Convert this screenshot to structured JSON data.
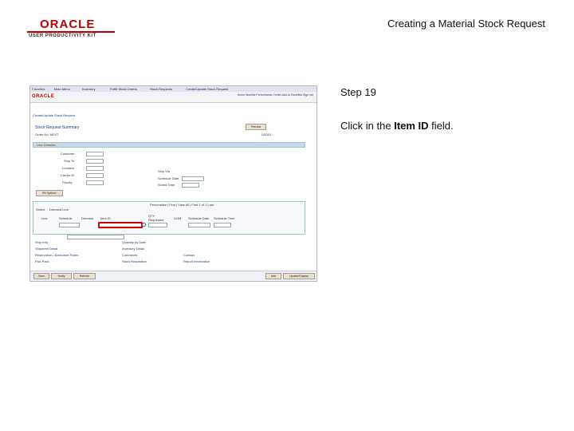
{
  "logo": {
    "brand": "ORACLE",
    "product": "USER PRODUCTIVITY KIT"
  },
  "doc_title": "Creating a Material Stock Request",
  "step": "Step 19",
  "instruction": {
    "prefix": "Click in the ",
    "field": "Item ID",
    "suffix": " field."
  },
  "screenshot": {
    "breadcrumb": [
      "Favorites",
      "Main Menu",
      "Inventory",
      "Fulfill Stock Orders",
      "Stock Requests",
      "Create/Update Stock Request"
    ],
    "brand": "ORACLE",
    "top_links": "Home  Worklist  Performance Center  Add to Favorites  Sign out",
    "page_heading": "Create/Update Stock Request",
    "summary_title": "Stock Request Summary",
    "order_label": "Order No: NEXT",
    "business_unit": "US001",
    "preview_button": "Preview",
    "line_defaults": "Line Defaults",
    "fields": [
      "Customer",
      "Ship To",
      "Location",
      "Carrier ID",
      "Priority"
    ],
    "fields_right": [
      "Ship Via",
      "Schedule Date",
      "Sched Time"
    ],
    "fill_rebuild": "Fill Options",
    "table_tabs": [
      "Select",
      "Demand Line"
    ],
    "table_cols": [
      "Line",
      "Schedule",
      "Demand",
      "Item ID",
      "QTY Requested",
      "UOM",
      "Schedule Date",
      "Schedule Time"
    ],
    "table_nav": "Personalize | Find | View All | First 1 of 1 Last",
    "links": [
      "Ship Info",
      "Shipment Detail",
      "Reservation / Backorder Rules",
      "Pick Pack"
    ],
    "links_mid": [
      "Quantity by Date",
      "Inventory Detail",
      "Comments",
      "Stock Requisition"
    ],
    "links_right": [
      "Contact",
      "Report Information"
    ],
    "bottom_buttons": [
      "Save",
      "Notify",
      "Refresh"
    ],
    "bottom_right_buttons": [
      "Add",
      "Update/Display"
    ]
  }
}
